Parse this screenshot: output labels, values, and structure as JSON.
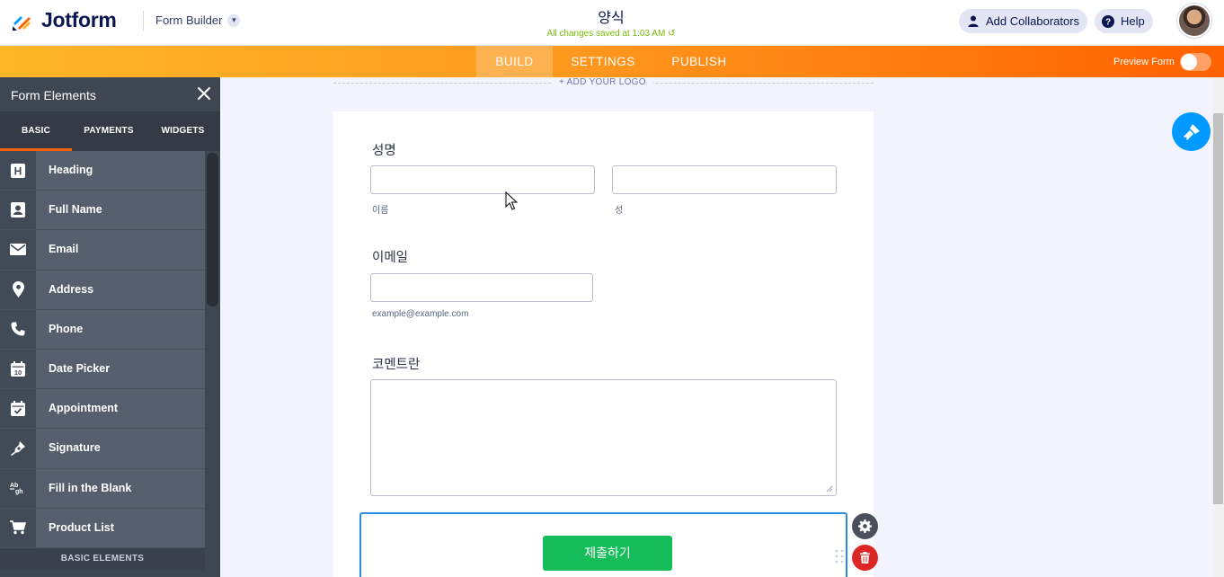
{
  "header": {
    "brand": "Jotform",
    "mode_selector": "Form Builder",
    "form_title": "양식",
    "save_status": "All changes saved at 1:03 AM",
    "add_collaborators": "Add Collaborators",
    "help": "Help"
  },
  "nav": {
    "tabs": [
      "BUILD",
      "SETTINGS",
      "PUBLISH"
    ],
    "active_tab": "BUILD",
    "preview_label": "Preview Form",
    "preview_enabled": false
  },
  "sidebar": {
    "title": "Form Elements",
    "tabs": [
      "BASIC",
      "PAYMENTS",
      "WIDGETS"
    ],
    "active_tab": "BASIC",
    "items": [
      {
        "label": "Heading",
        "icon": "heading-icon"
      },
      {
        "label": "Full Name",
        "icon": "contact-card-icon"
      },
      {
        "label": "Email",
        "icon": "envelope-icon"
      },
      {
        "label": "Address",
        "icon": "map-pin-icon"
      },
      {
        "label": "Phone",
        "icon": "phone-icon"
      },
      {
        "label": "Date Picker",
        "icon": "calendar-icon"
      },
      {
        "label": "Appointment",
        "icon": "calendar-check-icon"
      },
      {
        "label": "Signature",
        "icon": "pen-nib-icon"
      },
      {
        "label": "Fill in the Blank",
        "icon": "fill-blank-icon"
      },
      {
        "label": "Product List",
        "icon": "cart-icon"
      }
    ],
    "footer": "BASIC ELEMENTS"
  },
  "canvas": {
    "add_logo": "+ ADD YOUR LOGO",
    "fields": {
      "name": {
        "label": "성명",
        "first_sublabel": "이름",
        "last_sublabel": "성",
        "first_value": "",
        "last_value": ""
      },
      "email": {
        "label": "이메일",
        "sublabel": "example@example.com",
        "value": ""
      },
      "comments": {
        "label": "코멘트란",
        "value": ""
      }
    },
    "submit_label": "제출하기"
  },
  "colors": {
    "brand_navy": "#0a1551",
    "nav_orange_start": "#ffb629",
    "nav_orange_end": "#ff6100",
    "submit_green": "#18bd5b",
    "selection_blue": "#2b8ee0",
    "save_green": "#78bb07",
    "delete_red": "#dc2626",
    "paint_blue": "#0099ff"
  }
}
